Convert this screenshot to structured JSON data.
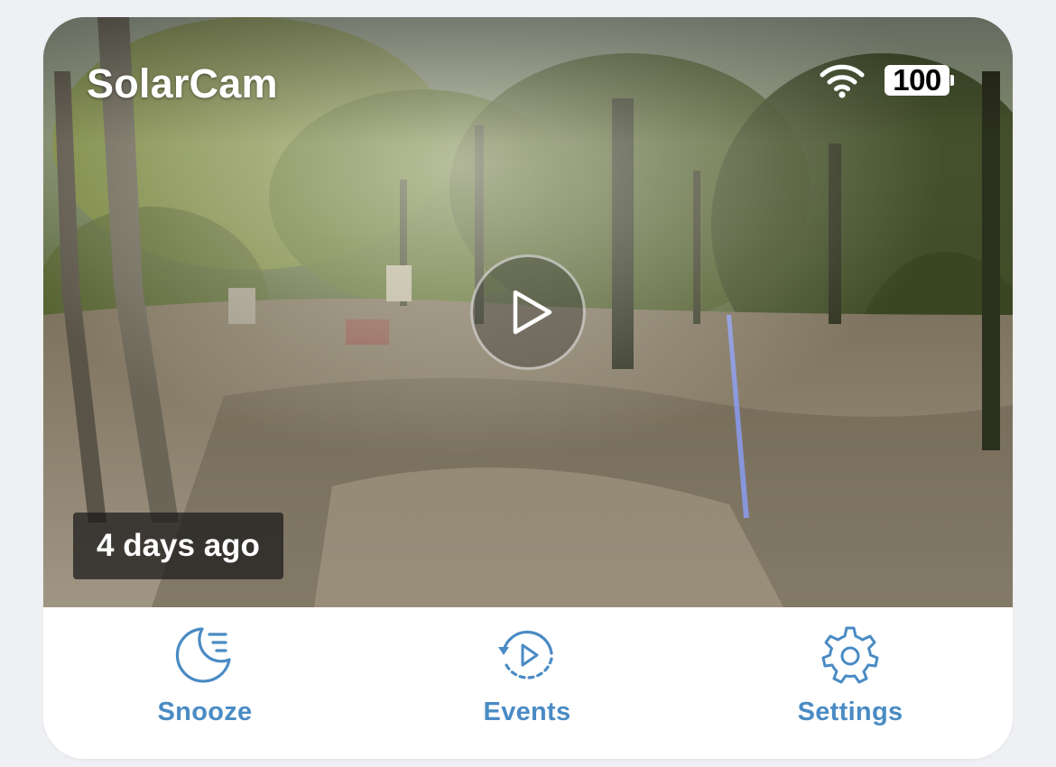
{
  "camera": {
    "title": "SolarCam",
    "battery": "100",
    "last_event": "4 days ago"
  },
  "icons": {
    "wifi": "wifi-icon",
    "battery": "battery-icon",
    "play": "play-icon",
    "snooze": "moon-snooze-icon",
    "events": "events-replay-icon",
    "settings": "gear-icon"
  },
  "actions": [
    {
      "label": "Snooze"
    },
    {
      "label": "Events"
    },
    {
      "label": "Settings"
    }
  ],
  "colors": {
    "accent": "#4a8bc4",
    "background": "#eef0f3",
    "card": "#ffffff"
  }
}
